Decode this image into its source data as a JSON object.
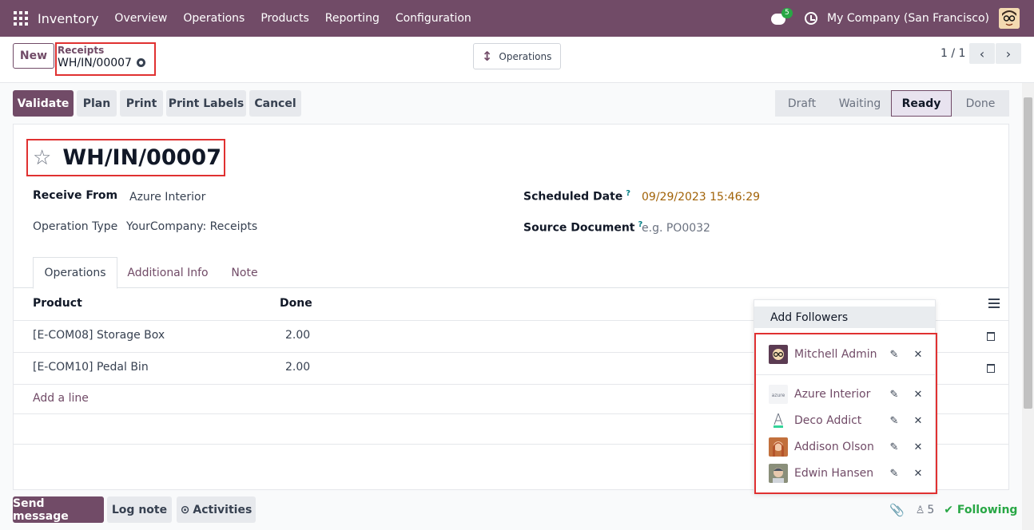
{
  "navbar": {
    "app_name": "Inventory",
    "menu": [
      "Overview",
      "Operations",
      "Products",
      "Reporting",
      "Configuration"
    ],
    "chat_badge": "5",
    "company": "My Company (San Francisco)"
  },
  "control_panel": {
    "new_label": "New",
    "breadcrumb_parent": "Receipts",
    "breadcrumb_current": "WH/IN/00007",
    "smart_button_label": "Operations",
    "pager": "1 / 1"
  },
  "actions": [
    "Validate",
    "Plan",
    "Print",
    "Print Labels",
    "Cancel"
  ],
  "status": {
    "stages": [
      "Draft",
      "Waiting",
      "Ready",
      "Done"
    ],
    "current": "Ready"
  },
  "record": {
    "title": "WH/IN/00007",
    "receive_from_label": "Receive From",
    "receive_from": "Azure Interior",
    "operation_type_label": "Operation Type",
    "operation_type": "YourCompany: Receipts",
    "scheduled_date_label": "Scheduled Date",
    "scheduled_date": "09/29/2023 15:46:29",
    "source_document_label": "Source Document",
    "source_document_placeholder": "e.g. PO0032",
    "help_mark": "?"
  },
  "tabs": [
    "Operations",
    "Additional Info",
    "Note"
  ],
  "table": {
    "headers": [
      "Product",
      "Done"
    ],
    "rows": [
      {
        "product": "[E-COM08] Storage Box",
        "done": "2.00"
      },
      {
        "product": "[E-COM10] Pedal Bin",
        "done": "2.00"
      }
    ],
    "add_line": "Add a line"
  },
  "followers_dropdown": {
    "add_label": "Add Followers",
    "followers": [
      {
        "name": "Mitchell Admin",
        "avatar_color": "#5b3b52"
      },
      {
        "name": "Azure Interior",
        "avatar_color": "#e5e7eb"
      },
      {
        "name": "Deco Addict",
        "avatar_color": "#d1fae5"
      },
      {
        "name": "Addison Olson",
        "avatar_color": "#c2703d"
      },
      {
        "name": "Edwin Hansen",
        "avatar_color": "#8a8f7a"
      }
    ],
    "edit_icon": "pencil-icon",
    "remove_icon": "close-icon"
  },
  "chatter": {
    "send_message": "Send message",
    "log_note": "Log note",
    "activities": "Activities",
    "followers_count": "5",
    "following": "Following"
  },
  "colors": {
    "brand": "#714b67",
    "highlight_box": "#e03131",
    "success": "#28a745"
  }
}
